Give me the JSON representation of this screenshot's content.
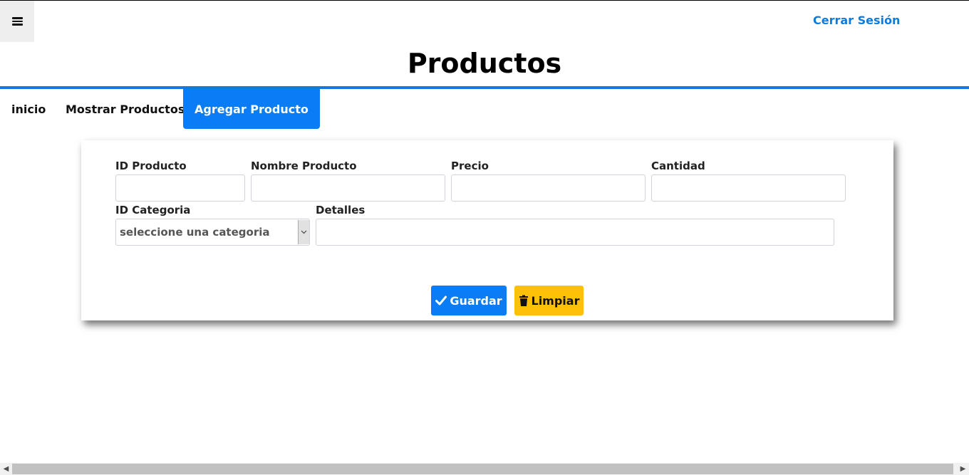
{
  "header": {
    "logout_label": "Cerrar Sesión",
    "title": "Productos"
  },
  "tabs": [
    {
      "label": "inicio",
      "active": false
    },
    {
      "label": "Mostrar Productos",
      "active": false
    },
    {
      "label": "Agregar Producto",
      "active": true
    }
  ],
  "form": {
    "id_producto_label": "ID Producto",
    "nombre_label": "Nombre Producto",
    "precio_label": "Precio",
    "cantidad_label": "Cantidad",
    "categoria_label": "ID Categoria",
    "categoria_selected": "seleccione una categoria",
    "detalles_label": "Detalles",
    "save_label": "Guardar",
    "clear_label": "Limpiar"
  },
  "colors": {
    "accent": "#0a7cf5",
    "header_line": "#1479dc",
    "warning": "#ffc107",
    "link": "#0d7bdc"
  },
  "icons": {
    "menu": "hamburger-icon",
    "save": "check-icon",
    "clear": "trash-icon"
  }
}
